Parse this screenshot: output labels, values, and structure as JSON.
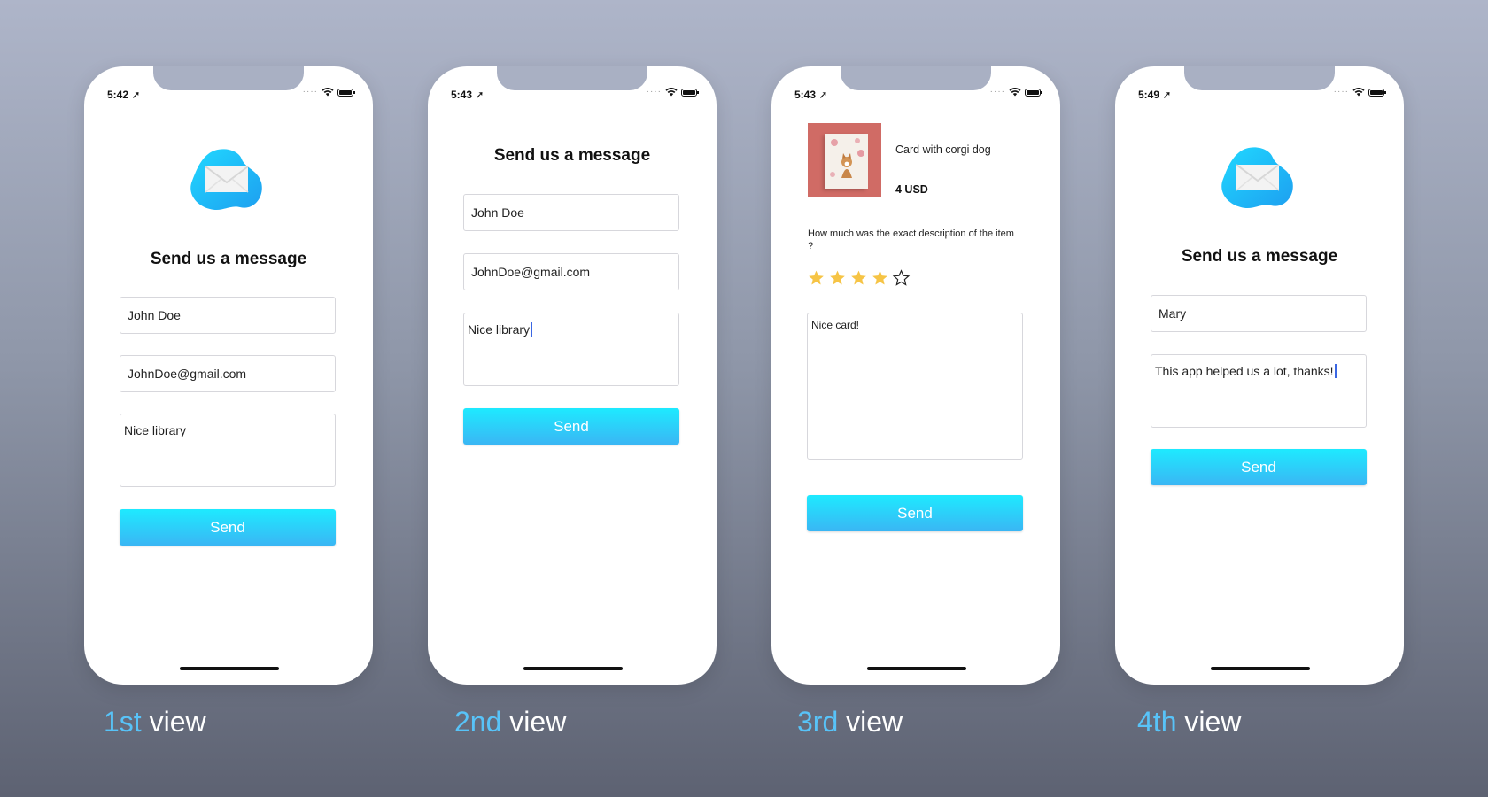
{
  "colors": {
    "accent": "#58c3f8",
    "button_top": "#1eeaff",
    "button_bottom": "#3ab6f4",
    "caption_text": "#ffffff"
  },
  "phones": [
    {
      "status_time": "5:42",
      "title": "Send us a message",
      "name_value": "John Doe",
      "email_value": "JohnDoe@gmail.com",
      "message_value": "Nice library",
      "send_label": "Send",
      "caption_num": "1st",
      "caption_word": "view"
    },
    {
      "status_time": "5:43",
      "title": "Send us a message",
      "name_value": "John Doe",
      "email_value": "JohnDoe@gmail.com",
      "message_value": "Nice library",
      "send_label": "Send",
      "caption_num": "2nd",
      "caption_word": "view"
    },
    {
      "status_time": "5:43",
      "product_name": "Card with corgi dog",
      "product_price": "4 USD",
      "question": "How much was the exact description of the item ?",
      "rating": 4,
      "rating_max": 5,
      "message_value": "Nice card!",
      "send_label": "Send",
      "caption_num": "3rd",
      "caption_word": "view"
    },
    {
      "status_time": "5:49",
      "title": "Send us a message",
      "name_value": "Mary",
      "message_value": "This app helped us a lot, thanks!",
      "send_label": "Send",
      "caption_num": "4th",
      "caption_word": "view"
    }
  ],
  "icons": [
    "mail-logo-icon",
    "location-arrow-icon",
    "wifi-icon",
    "battery-icon",
    "star-icon",
    "star-outline-icon"
  ]
}
